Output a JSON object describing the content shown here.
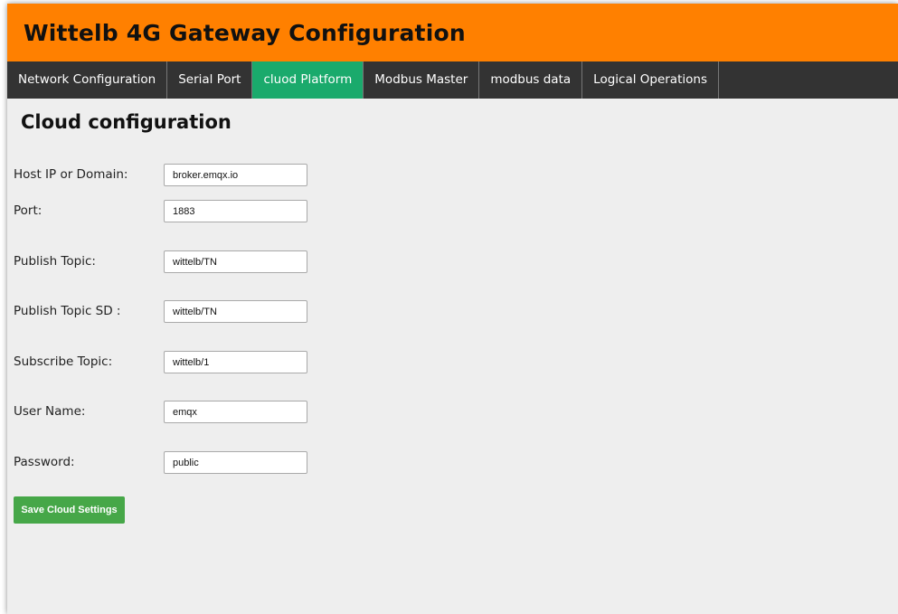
{
  "header": {
    "title": "Wittelb 4G Gateway Configuration"
  },
  "nav": {
    "tabs": [
      {
        "label": "Network Configuration"
      },
      {
        "label": "Serial Port"
      },
      {
        "label": "cluod Platform",
        "active": true
      },
      {
        "label": "Modbus Master"
      },
      {
        "label": "modbus data"
      },
      {
        "label": "Logical Operations"
      }
    ]
  },
  "page": {
    "title": "Cloud configuration"
  },
  "form": {
    "host": {
      "label": "Host IP or Domain:",
      "value": "broker.emqx.io"
    },
    "port": {
      "label": "Port:",
      "value": "1883"
    },
    "publish_topic": {
      "label": "Publish Topic:",
      "value": "wittelb/TN"
    },
    "publish_topic_sd": {
      "label": "Publish Topic SD :",
      "value": "wittelb/TN"
    },
    "subscribe_topic": {
      "label": "Subscribe Topic:",
      "value": "wittelb/1"
    },
    "user_name": {
      "label": "User Name:",
      "value": "emqx"
    },
    "password": {
      "label": "Password:",
      "value": "public"
    }
  },
  "actions": {
    "save_label": "Save Cloud Settings"
  },
  "colors": {
    "header": "#ff8000",
    "nav": "#333333",
    "active_tab": "#1aaa6c",
    "save_button": "#46a748"
  }
}
